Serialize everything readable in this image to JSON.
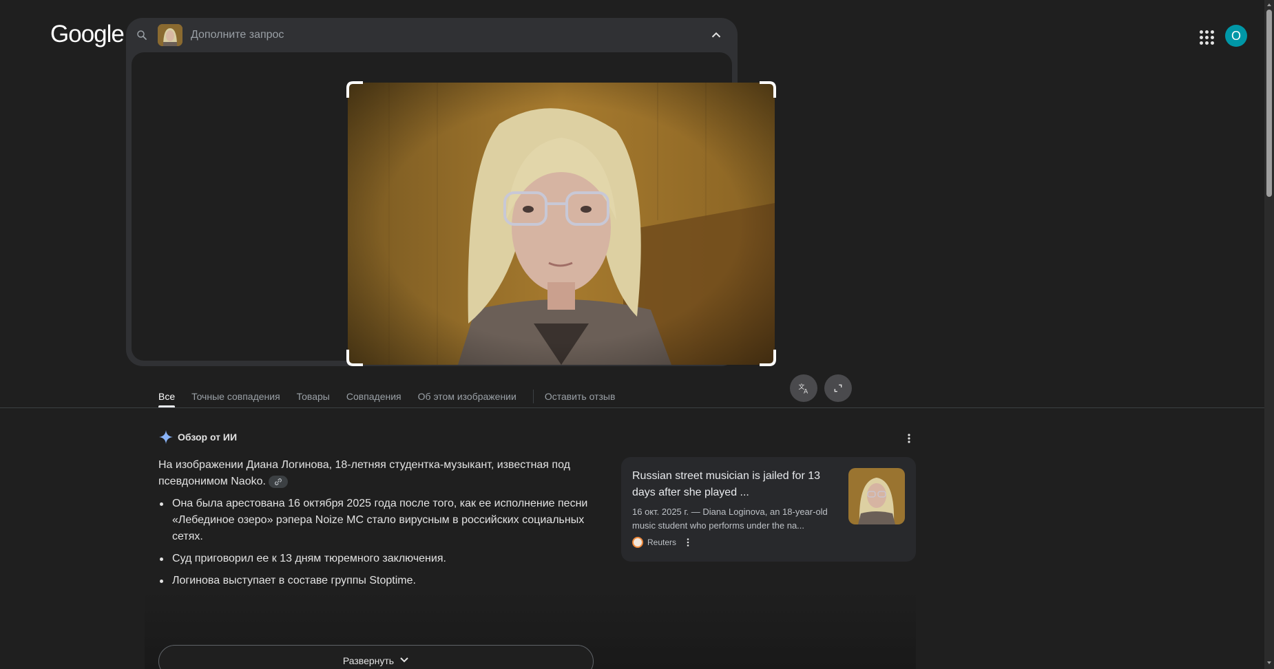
{
  "header": {
    "logo_text": "Google",
    "avatar_initial": "О"
  },
  "search": {
    "placeholder": "Дополните запрос"
  },
  "tabs": [
    {
      "label": "Все",
      "active": true
    },
    {
      "label": "Точные совпадения"
    },
    {
      "label": "Товары"
    },
    {
      "label": "Совпадения"
    },
    {
      "label": "Об этом изображении"
    },
    {
      "label": "Оставить отзыв"
    }
  ],
  "ai_overview": {
    "title": "Обзор от ИИ",
    "intro": "На изображении Диана Логинова, 18-летняя студентка-музыкант, известная под псевдонимом Naoko.",
    "bullets": [
      "Она была арестована 16 октября 2025 года после того, как ее исполнение песни «Лебединое озеро» рэпера Noize MC стало вирусным в российских социальных сетях.",
      "Суд приговорил ее к 13 дням тюремного заключения.",
      "Логинова выступает в составе группы Stoptime."
    ],
    "expand_label": "Развернуть"
  },
  "source_card": {
    "title": "Russian street musician is jailed for 13 days after she played ...",
    "snippet": "16 окт. 2025 г. — Diana Loginova, an 18-year-old music student who performs under the na...",
    "source_name": "Reuters"
  },
  "colors": {
    "background": "#1f1f1f",
    "panel": "#303134",
    "avatar": "#0097a7",
    "ai_spark": "#8ab4f8"
  }
}
